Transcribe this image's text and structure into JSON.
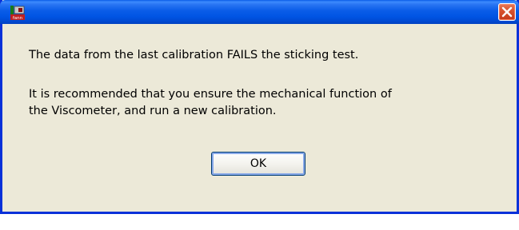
{
  "window": {
    "app_icon": "fann-app-icon",
    "app_icon_text": "fann",
    "close_icon": "close-icon",
    "colors": {
      "title_bar": "#0054e3",
      "frame": "#0831d9",
      "dialog_bg": "#ece9d8",
      "close_button": "#d9532e"
    }
  },
  "dialog": {
    "message_line1": "The data from the last calibration FAILS the sticking test.",
    "message_line2": "It is recommended that you ensure the mechanical function of",
    "message_line3": "the Viscometer, and run a new calibration.",
    "ok_label": "OK"
  }
}
